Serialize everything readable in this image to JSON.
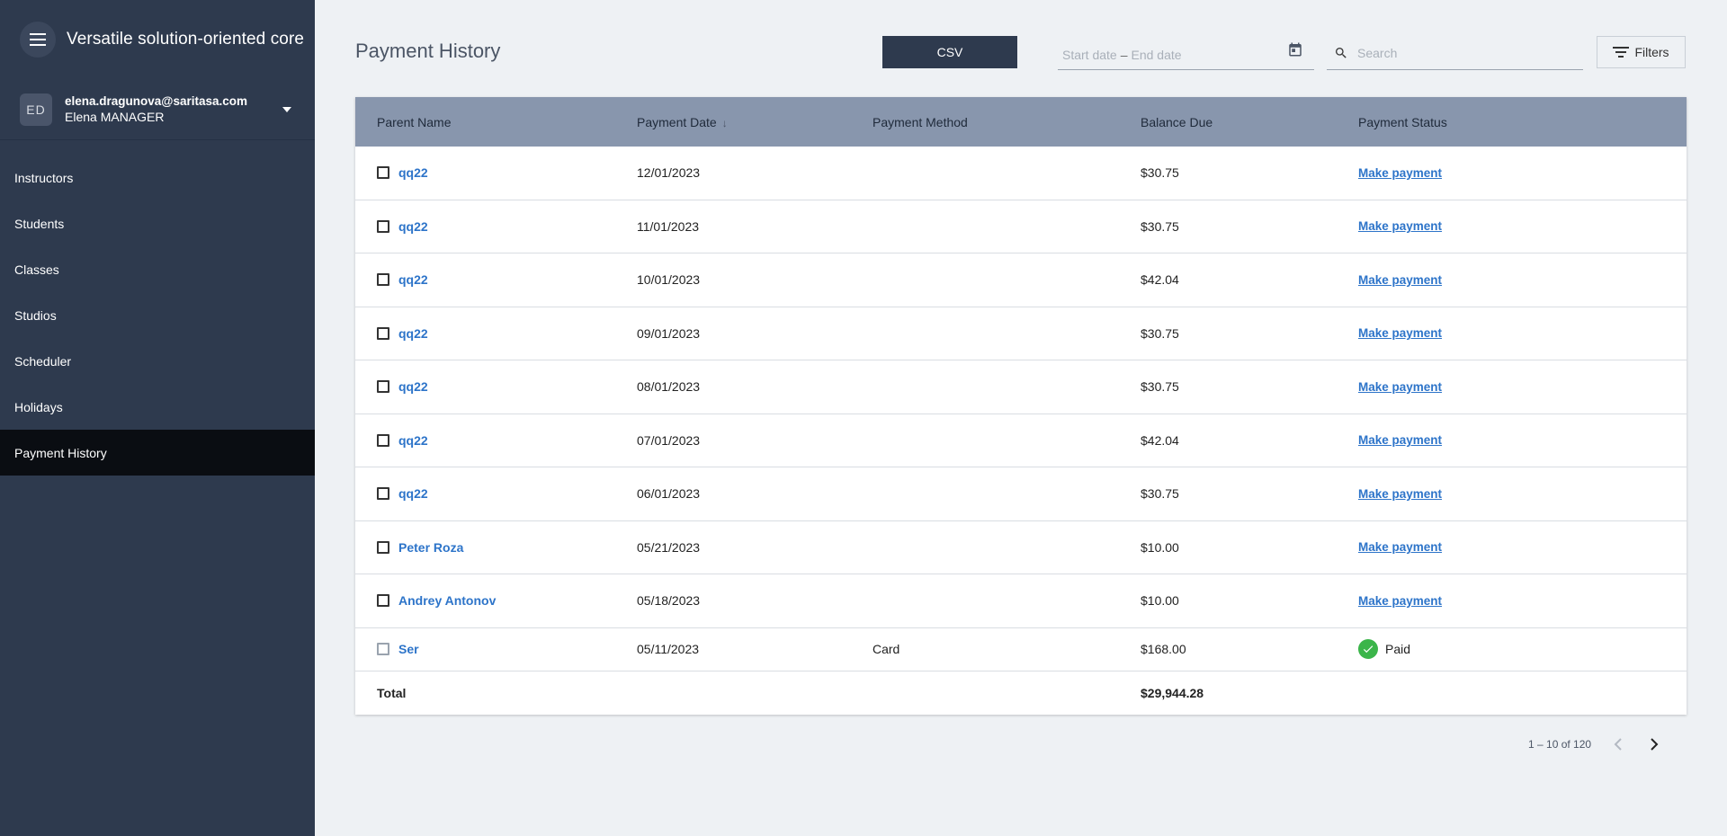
{
  "app": {
    "title": "Versatile solution-oriented core"
  },
  "user": {
    "initials": "ED",
    "email": "elena.dragunova@saritasa.com",
    "name": "Elena MANAGER"
  },
  "sidebar": {
    "items": [
      {
        "label": "Instructors",
        "active": false
      },
      {
        "label": "Students",
        "active": false
      },
      {
        "label": "Classes",
        "active": false
      },
      {
        "label": "Studios",
        "active": false
      },
      {
        "label": "Scheduler",
        "active": false
      },
      {
        "label": "Holidays",
        "active": false
      },
      {
        "label": "Payment History",
        "active": true
      }
    ]
  },
  "page": {
    "title": "Payment History"
  },
  "toolbar": {
    "csv_label": "CSV",
    "start_date_placeholder": "Start date",
    "date_separator": "–",
    "end_date_placeholder": "End date",
    "search_placeholder": "Search",
    "filters_label": "Filters"
  },
  "table": {
    "headers": {
      "parent_name": "Parent Name",
      "payment_date": "Payment Date",
      "payment_method": "Payment Method",
      "balance_due": "Balance Due",
      "payment_status": "Payment Status"
    },
    "rows": [
      {
        "parent": "qq22",
        "date": "12/01/2023",
        "method": "",
        "balance": "$30.75",
        "status": "Make payment",
        "paid": false
      },
      {
        "parent": "qq22",
        "date": "11/01/2023",
        "method": "",
        "balance": "$30.75",
        "status": "Make payment",
        "paid": false
      },
      {
        "parent": "qq22",
        "date": "10/01/2023",
        "method": "",
        "balance": "$42.04",
        "status": "Make payment",
        "paid": false
      },
      {
        "parent": "qq22",
        "date": "09/01/2023",
        "method": "",
        "balance": "$30.75",
        "status": "Make payment",
        "paid": false
      },
      {
        "parent": "qq22",
        "date": "08/01/2023",
        "method": "",
        "balance": "$30.75",
        "status": "Make payment",
        "paid": false
      },
      {
        "parent": "qq22",
        "date": "07/01/2023",
        "method": "",
        "balance": "$42.04",
        "status": "Make payment",
        "paid": false
      },
      {
        "parent": "qq22",
        "date": "06/01/2023",
        "method": "",
        "balance": "$30.75",
        "status": "Make payment",
        "paid": false
      },
      {
        "parent": "Peter Roza",
        "date": "05/21/2023",
        "method": "",
        "balance": "$10.00",
        "status": "Make payment",
        "paid": false
      },
      {
        "parent": "Andrey Antonov",
        "date": "05/18/2023",
        "method": "",
        "balance": "$10.00",
        "status": "Make payment",
        "paid": false
      },
      {
        "parent": "Ser",
        "date": "05/11/2023",
        "method": "Card",
        "balance": "$168.00",
        "status": "Paid",
        "paid": true
      }
    ],
    "total_label": "Total",
    "total_value": "$29,944.28"
  },
  "pagination": {
    "range_text": "1 – 10 of 120"
  },
  "colors": {
    "sidebar_bg": "#2e3a4e",
    "header_bg": "#8896ad",
    "link": "#2d74c9",
    "paid_green": "#3bb54a"
  }
}
